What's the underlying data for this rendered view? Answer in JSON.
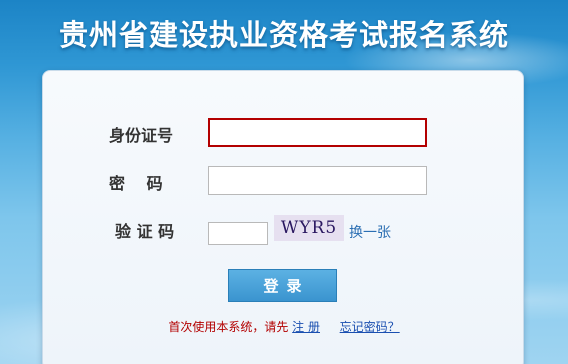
{
  "header": {
    "title": "贵州省建设执业资格考试报名系统"
  },
  "form": {
    "id_label": "身份证号",
    "id_value": "",
    "password_label": "密　 码",
    "password_value": "",
    "captcha_label": "验 证 码",
    "captcha_value": "",
    "captcha_code": "WYR5",
    "refresh_label": "换一张",
    "login_label": "登录"
  },
  "footer": {
    "note": "首次使用本系统，请先",
    "register_link": "注 册",
    "forgot_link": "忘记密码？"
  },
  "colors": {
    "background_top": "#1c84c6",
    "background_bottom": "#9fd4f1",
    "panel": "#f2f7fb",
    "focus_border": "#b30000",
    "button": "#3a94cf",
    "link": "#2b6fb3",
    "note": "#b30000"
  }
}
